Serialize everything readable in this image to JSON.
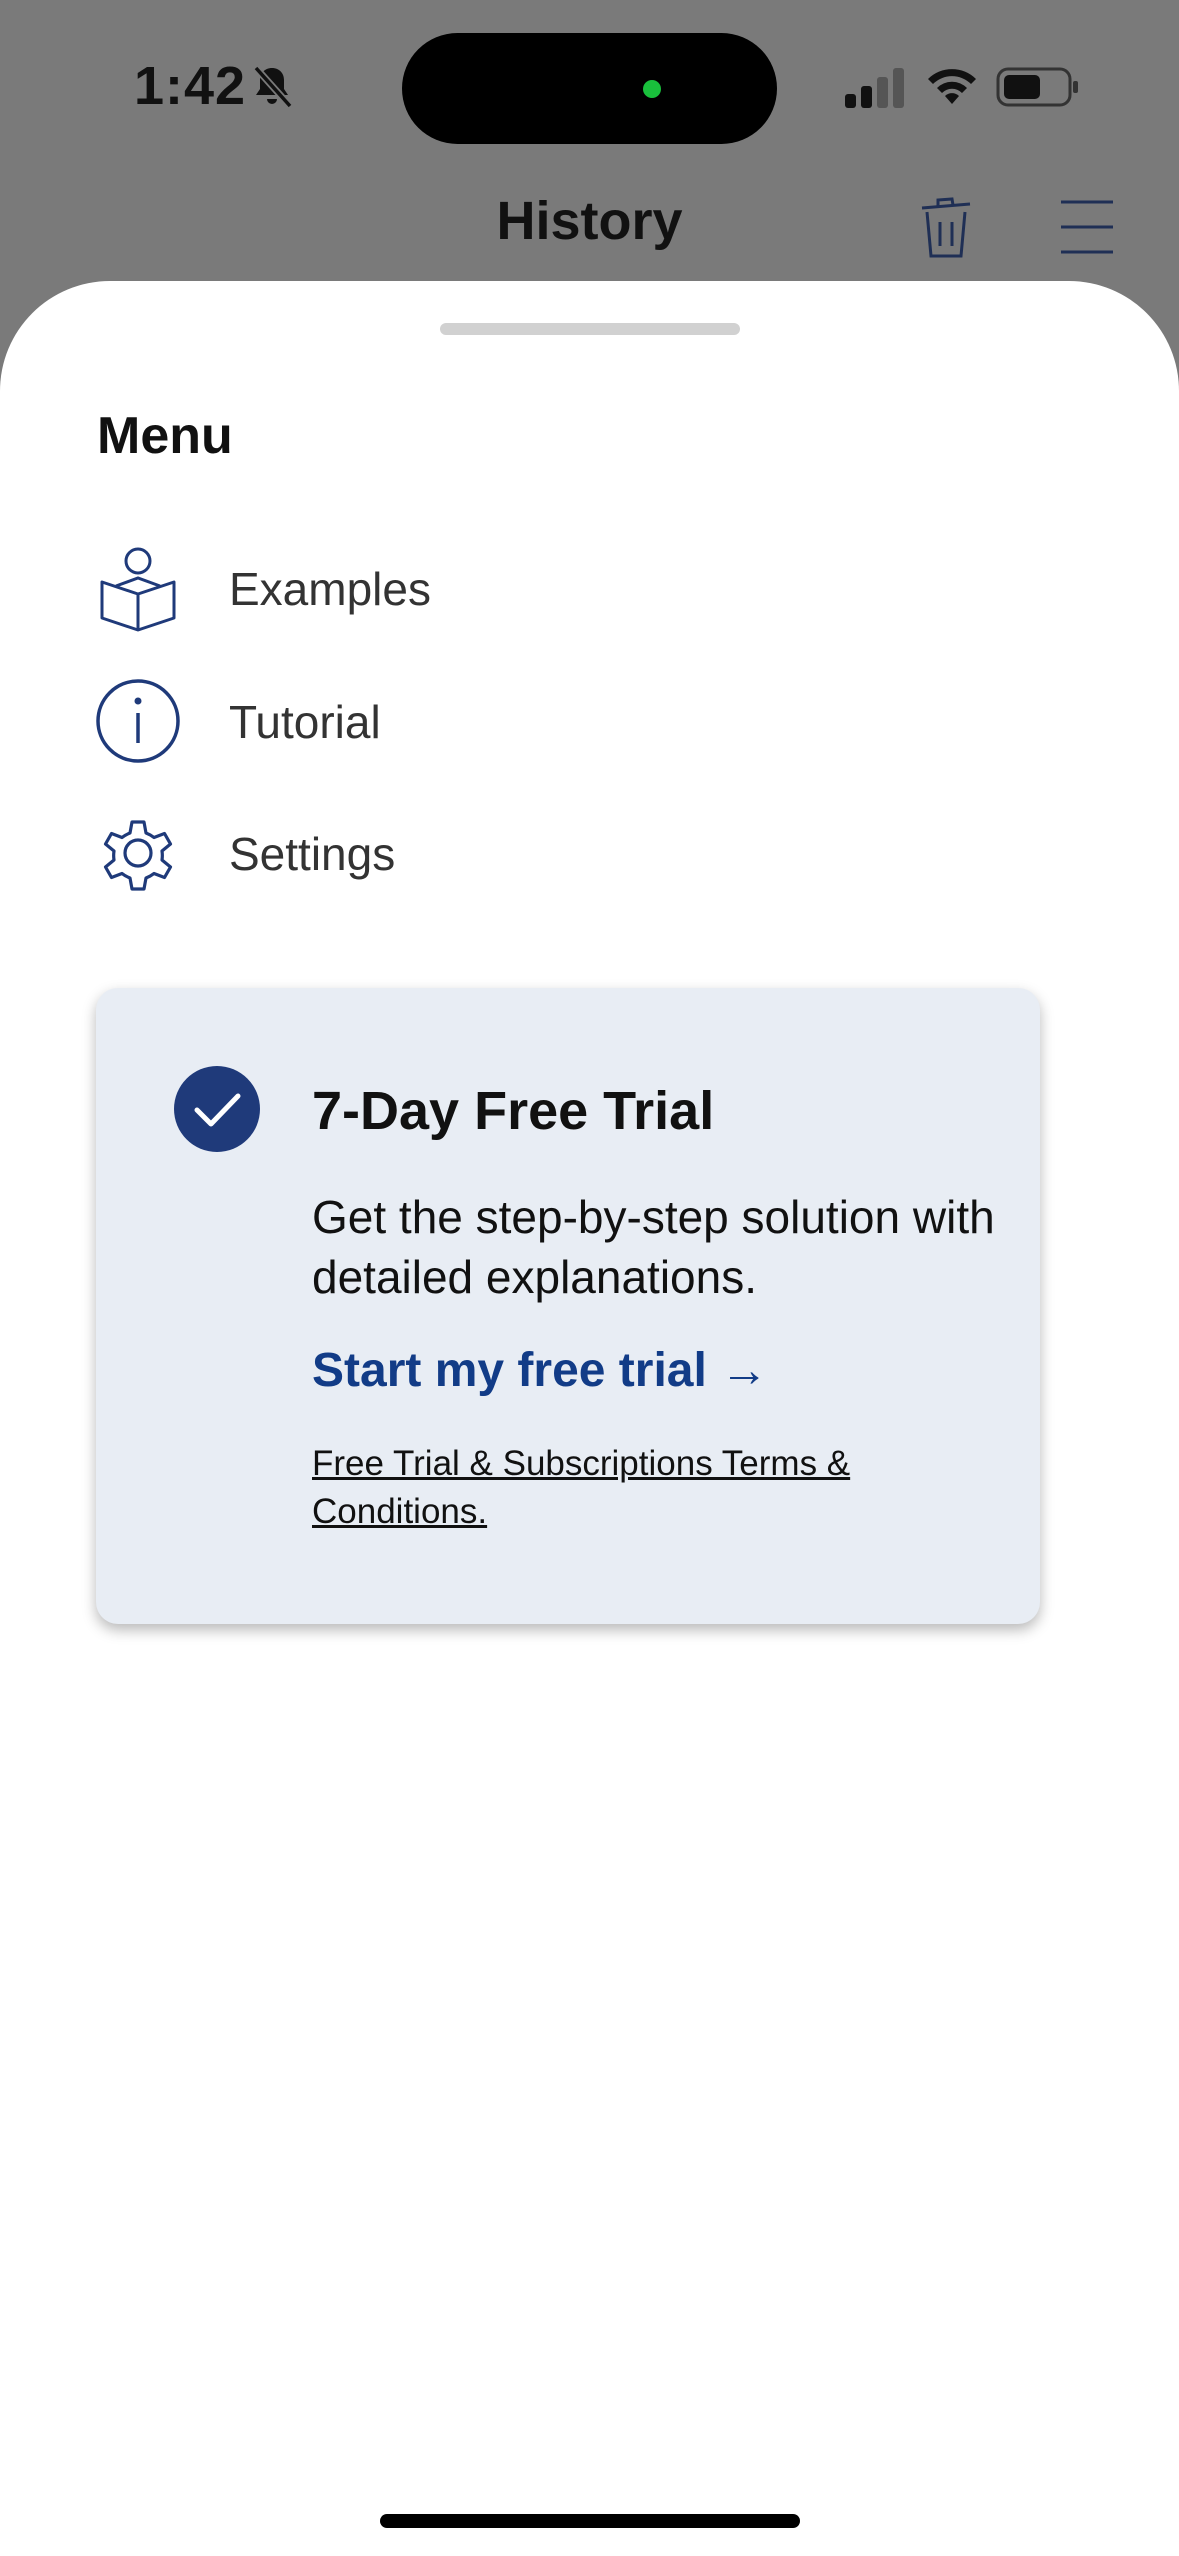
{
  "status_bar": {
    "time": "1:42"
  },
  "header": {
    "title": "History"
  },
  "sheet": {
    "menu_title": "Menu",
    "items": [
      {
        "label": "Examples",
        "icon": "book-reader-icon"
      },
      {
        "label": "Tutorial",
        "icon": "info-icon"
      },
      {
        "label": "Settings",
        "icon": "gear-icon"
      }
    ]
  },
  "trial": {
    "title": "7-Day Free Trial",
    "description": "Get the step-by-step solution with detailed explanations.",
    "cta": "Start my free trial →",
    "terms": "Free Trial & Subscriptions Terms & Conditions."
  },
  "colors": {
    "accent": "#1f3a7a",
    "link": "#123c87",
    "card_bg": "#e8edf4",
    "dim_overlay": "#7a7a7a"
  }
}
